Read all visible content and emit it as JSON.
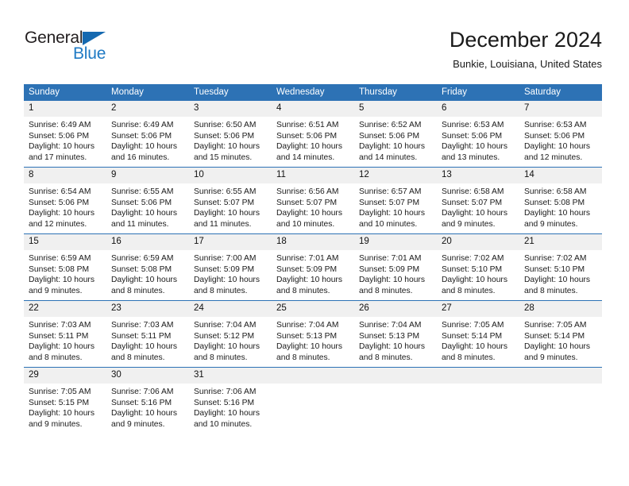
{
  "logo": {
    "name_part1": "General",
    "name_part2": "Blue",
    "flag_icon": "triangle-flag-icon",
    "color_dark": "#231f20",
    "color_blue": "#1f7ac4"
  },
  "header": {
    "month_title": "December 2024",
    "location": "Bunkie, Louisiana, United States"
  },
  "theme": {
    "header_blue": "#2d72b5",
    "daynum_gray": "#f0f0f0",
    "text_dark": "#1a1a1a"
  },
  "calendar": {
    "weekday_headers": [
      "Sunday",
      "Monday",
      "Tuesday",
      "Wednesday",
      "Thursday",
      "Friday",
      "Saturday"
    ],
    "weeks": [
      [
        {
          "day": "1",
          "sunrise": "Sunrise: 6:49 AM",
          "sunset": "Sunset: 5:06 PM",
          "daylight": "Daylight: 10 hours and 17 minutes."
        },
        {
          "day": "2",
          "sunrise": "Sunrise: 6:49 AM",
          "sunset": "Sunset: 5:06 PM",
          "daylight": "Daylight: 10 hours and 16 minutes."
        },
        {
          "day": "3",
          "sunrise": "Sunrise: 6:50 AM",
          "sunset": "Sunset: 5:06 PM",
          "daylight": "Daylight: 10 hours and 15 minutes."
        },
        {
          "day": "4",
          "sunrise": "Sunrise: 6:51 AM",
          "sunset": "Sunset: 5:06 PM",
          "daylight": "Daylight: 10 hours and 14 minutes."
        },
        {
          "day": "5",
          "sunrise": "Sunrise: 6:52 AM",
          "sunset": "Sunset: 5:06 PM",
          "daylight": "Daylight: 10 hours and 14 minutes."
        },
        {
          "day": "6",
          "sunrise": "Sunrise: 6:53 AM",
          "sunset": "Sunset: 5:06 PM",
          "daylight": "Daylight: 10 hours and 13 minutes."
        },
        {
          "day": "7",
          "sunrise": "Sunrise: 6:53 AM",
          "sunset": "Sunset: 5:06 PM",
          "daylight": "Daylight: 10 hours and 12 minutes."
        }
      ],
      [
        {
          "day": "8",
          "sunrise": "Sunrise: 6:54 AM",
          "sunset": "Sunset: 5:06 PM",
          "daylight": "Daylight: 10 hours and 12 minutes."
        },
        {
          "day": "9",
          "sunrise": "Sunrise: 6:55 AM",
          "sunset": "Sunset: 5:06 PM",
          "daylight": "Daylight: 10 hours and 11 minutes."
        },
        {
          "day": "10",
          "sunrise": "Sunrise: 6:55 AM",
          "sunset": "Sunset: 5:07 PM",
          "daylight": "Daylight: 10 hours and 11 minutes."
        },
        {
          "day": "11",
          "sunrise": "Sunrise: 6:56 AM",
          "sunset": "Sunset: 5:07 PM",
          "daylight": "Daylight: 10 hours and 10 minutes."
        },
        {
          "day": "12",
          "sunrise": "Sunrise: 6:57 AM",
          "sunset": "Sunset: 5:07 PM",
          "daylight": "Daylight: 10 hours and 10 minutes."
        },
        {
          "day": "13",
          "sunrise": "Sunrise: 6:58 AM",
          "sunset": "Sunset: 5:07 PM",
          "daylight": "Daylight: 10 hours and 9 minutes."
        },
        {
          "day": "14",
          "sunrise": "Sunrise: 6:58 AM",
          "sunset": "Sunset: 5:08 PM",
          "daylight": "Daylight: 10 hours and 9 minutes."
        }
      ],
      [
        {
          "day": "15",
          "sunrise": "Sunrise: 6:59 AM",
          "sunset": "Sunset: 5:08 PM",
          "daylight": "Daylight: 10 hours and 9 minutes."
        },
        {
          "day": "16",
          "sunrise": "Sunrise: 6:59 AM",
          "sunset": "Sunset: 5:08 PM",
          "daylight": "Daylight: 10 hours and 8 minutes."
        },
        {
          "day": "17",
          "sunrise": "Sunrise: 7:00 AM",
          "sunset": "Sunset: 5:09 PM",
          "daylight": "Daylight: 10 hours and 8 minutes."
        },
        {
          "day": "18",
          "sunrise": "Sunrise: 7:01 AM",
          "sunset": "Sunset: 5:09 PM",
          "daylight": "Daylight: 10 hours and 8 minutes."
        },
        {
          "day": "19",
          "sunrise": "Sunrise: 7:01 AM",
          "sunset": "Sunset: 5:09 PM",
          "daylight": "Daylight: 10 hours and 8 minutes."
        },
        {
          "day": "20",
          "sunrise": "Sunrise: 7:02 AM",
          "sunset": "Sunset: 5:10 PM",
          "daylight": "Daylight: 10 hours and 8 minutes."
        },
        {
          "day": "21",
          "sunrise": "Sunrise: 7:02 AM",
          "sunset": "Sunset: 5:10 PM",
          "daylight": "Daylight: 10 hours and 8 minutes."
        }
      ],
      [
        {
          "day": "22",
          "sunrise": "Sunrise: 7:03 AM",
          "sunset": "Sunset: 5:11 PM",
          "daylight": "Daylight: 10 hours and 8 minutes."
        },
        {
          "day": "23",
          "sunrise": "Sunrise: 7:03 AM",
          "sunset": "Sunset: 5:11 PM",
          "daylight": "Daylight: 10 hours and 8 minutes."
        },
        {
          "day": "24",
          "sunrise": "Sunrise: 7:04 AM",
          "sunset": "Sunset: 5:12 PM",
          "daylight": "Daylight: 10 hours and 8 minutes."
        },
        {
          "day": "25",
          "sunrise": "Sunrise: 7:04 AM",
          "sunset": "Sunset: 5:13 PM",
          "daylight": "Daylight: 10 hours and 8 minutes."
        },
        {
          "day": "26",
          "sunrise": "Sunrise: 7:04 AM",
          "sunset": "Sunset: 5:13 PM",
          "daylight": "Daylight: 10 hours and 8 minutes."
        },
        {
          "day": "27",
          "sunrise": "Sunrise: 7:05 AM",
          "sunset": "Sunset: 5:14 PM",
          "daylight": "Daylight: 10 hours and 8 minutes."
        },
        {
          "day": "28",
          "sunrise": "Sunrise: 7:05 AM",
          "sunset": "Sunset: 5:14 PM",
          "daylight": "Daylight: 10 hours and 9 minutes."
        }
      ],
      [
        {
          "day": "29",
          "sunrise": "Sunrise: 7:05 AM",
          "sunset": "Sunset: 5:15 PM",
          "daylight": "Daylight: 10 hours and 9 minutes."
        },
        {
          "day": "30",
          "sunrise": "Sunrise: 7:06 AM",
          "sunset": "Sunset: 5:16 PM",
          "daylight": "Daylight: 10 hours and 9 minutes."
        },
        {
          "day": "31",
          "sunrise": "Sunrise: 7:06 AM",
          "sunset": "Sunset: 5:16 PM",
          "daylight": "Daylight: 10 hours and 10 minutes."
        },
        {
          "day": "",
          "sunrise": "",
          "sunset": "",
          "daylight": ""
        },
        {
          "day": "",
          "sunrise": "",
          "sunset": "",
          "daylight": ""
        },
        {
          "day": "",
          "sunrise": "",
          "sunset": "",
          "daylight": ""
        },
        {
          "day": "",
          "sunrise": "",
          "sunset": "",
          "daylight": ""
        }
      ]
    ]
  }
}
